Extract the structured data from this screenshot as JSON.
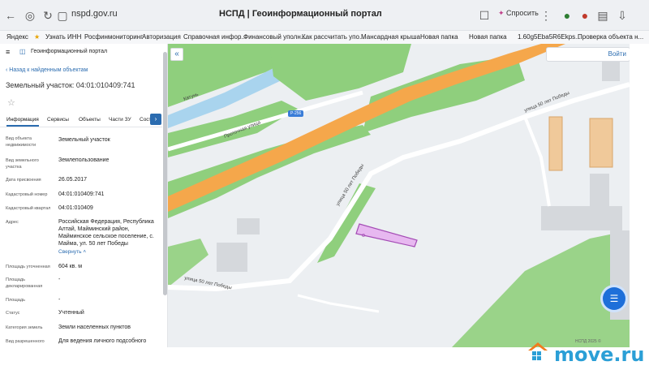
{
  "browser": {
    "url": "nspd.gov.ru",
    "page_title": "НСПД | Геоинформационный портал",
    "save_label": "Спросить",
    "bookmarks": [
      "Яндекс",
      "Узнать ИНН",
      "Росфинмониторинг",
      "Авторизация",
      "Справочная инфор...",
      "Финансовый уполн...",
      "Как рассчитать упо...",
      "Мансардная крыша",
      "Новая папка",
      "Новая папка",
      "1.60g5Eba5R6Ekps...",
      "Проверка объекта н..."
    ]
  },
  "sidebar": {
    "portal_name": "Геоинформационный портал",
    "back_link": "Назад к найденным объектам",
    "object_title": "Земельный участок: 04:01:010409:741",
    "tabs": [
      "Информация",
      "Сервисы",
      "Объекты",
      "Части ЗУ",
      "Сост"
    ],
    "fields": [
      {
        "label": "Вид объекта недвижимости",
        "value": "Земельный участок"
      },
      {
        "label": "Вид земельного участка",
        "value": "Землепользование"
      },
      {
        "label": "Дата присвоения",
        "value": "26.05.2017"
      },
      {
        "label": "Кадастровый номер",
        "value": "04:01:010409:741"
      },
      {
        "label": "Кадастровый квартал",
        "value": "04:01:010409"
      },
      {
        "label": "Адрес",
        "value": "Российская Федерация, Республика Алтай, Майминский район, Майминское сельское поселение, с. Майма, ул. 50 лет Победы"
      },
      {
        "label": "Площадь уточненная",
        "value": "604 кв. м"
      },
      {
        "label": "Площадь декларированная",
        "value": "-"
      },
      {
        "label": "Площадь",
        "value": "-"
      },
      {
        "label": "Статус",
        "value": "Учтенный"
      },
      {
        "label": "Категория земель",
        "value": "Земли населенных пунктов"
      },
      {
        "label": "Вид разрешенного",
        "value": "Для ведения личного подсобного"
      }
    ],
    "collapse_label": "Свернуть"
  },
  "map": {
    "search_button": "Войти",
    "road_badge": "Р-256",
    "streets": [
      "Проточная улица",
      "улица 50 лет Победы",
      "улица 50 лет Победы",
      "улица 50 лет Победы",
      "Катунь"
    ],
    "copyright": "НСПД 2025 ©"
  },
  "watermark": {
    "brand": "move.ru"
  },
  "colors": {
    "accent": "#2b6cb0",
    "parcel": "#d07ad8",
    "highway": "#f5a74b",
    "green": "#8fcf7d"
  }
}
